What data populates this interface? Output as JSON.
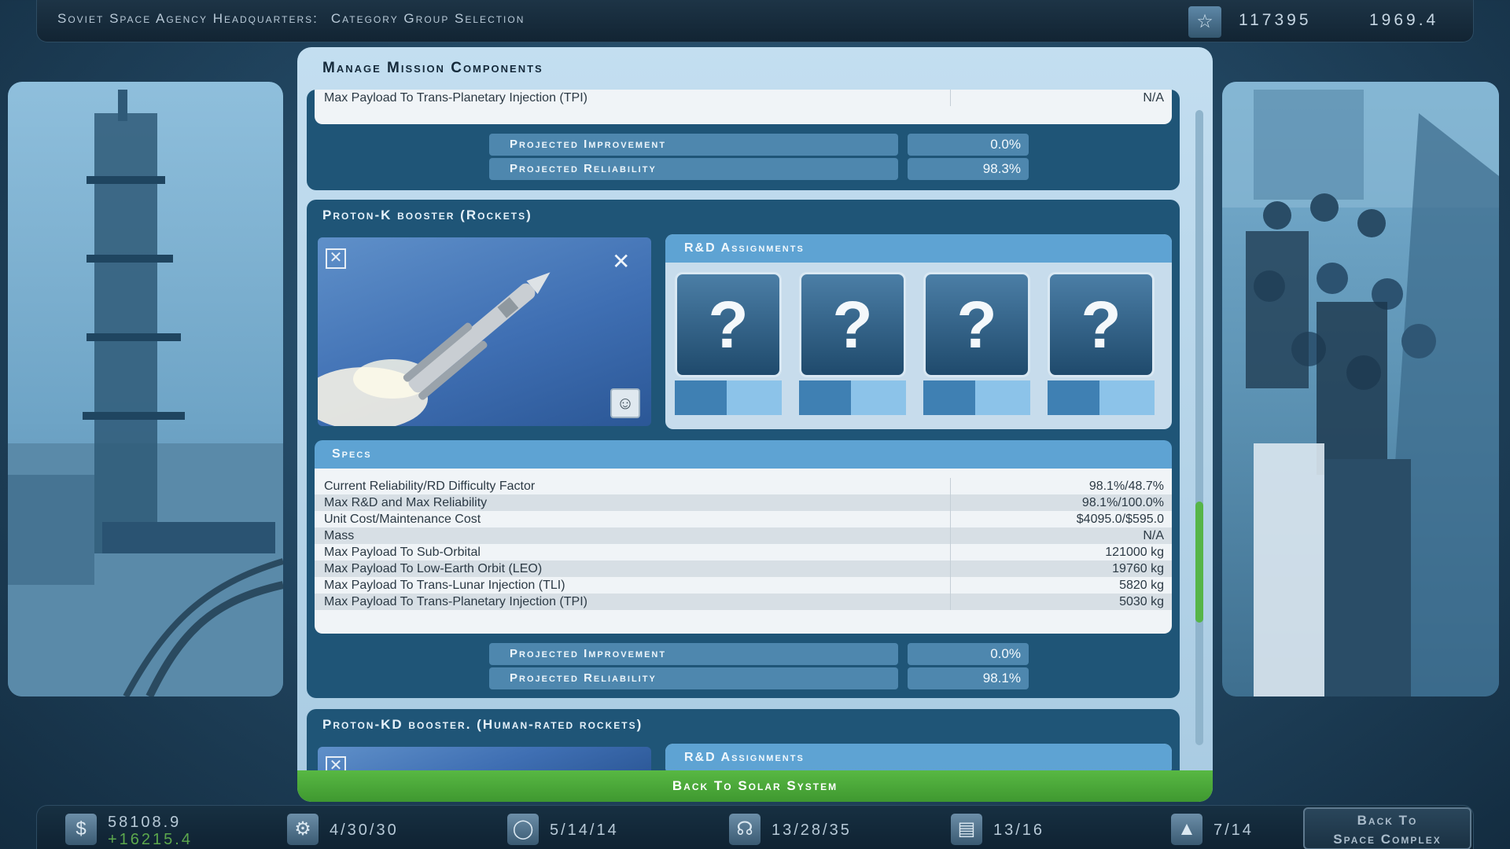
{
  "topbar": {
    "location": "Soviet Space Agency Headquarters:",
    "screen": "Category Group Selection",
    "prestige": "117395",
    "date": "1969.4"
  },
  "panel": {
    "header": "Manage Mission Components",
    "back_button": "Back To Solar System"
  },
  "card0": {
    "row_label": "Max Payload To Trans-Planetary Injection (TPI)",
    "row_value": "N/A",
    "improvement_label": "Projected Improvement",
    "improvement_value": "0.0%",
    "reliability_label": "Projected Reliability",
    "reliability_value": "98.3%"
  },
  "card1": {
    "title": "Proton-K booster (Rockets)",
    "rd_header": "R&D Assignments",
    "slots": [
      "?",
      "?",
      "?",
      "?"
    ],
    "specs_header": "Specs",
    "specs": [
      {
        "label": "Current Reliability/RD Difficulty Factor",
        "value": "98.1%/48.7%"
      },
      {
        "label": "Max R&D and Max Reliability",
        "value": "98.1%/100.0%"
      },
      {
        "label": "Unit Cost/Maintenance Cost",
        "value": "$4095.0/$595.0"
      },
      {
        "label": "Mass",
        "value": "N/A"
      },
      {
        "label": "Max Payload To Sub-Orbital",
        "value": "121000 kg"
      },
      {
        "label": "Max Payload To Low-Earth Orbit (LEO)",
        "value": "19760 kg"
      },
      {
        "label": "Max Payload To Trans-Lunar Injection (TLI)",
        "value": "5820 kg"
      },
      {
        "label": "Max Payload To Trans-Planetary Injection (TPI)",
        "value": "5030 kg"
      }
    ],
    "improvement_label": "Projected Improvement",
    "improvement_value": "0.0%",
    "reliability_label": "Projected Reliability",
    "reliability_value": "98.1%"
  },
  "card2": {
    "title": "Proton-KD booster. (Human-rated rockets)",
    "rd_header": "R&D Assignments"
  },
  "bottombar": {
    "money": "58108.9",
    "income": "+16215.4",
    "stat1": "4/30/30",
    "stat2": "5/14/14",
    "stat3": "13/28/35",
    "stat4": "13/16",
    "stat5": "7/14",
    "back_line1": "Back To",
    "back_line2": "Space Complex"
  },
  "icons": {
    "star": "star-icon",
    "money": "dollar-icon",
    "gear": "gear-icon",
    "capsule": "capsule-icon",
    "headset": "headset-icon",
    "folder": "folder-icon",
    "city": "city-icon"
  },
  "colors": {
    "accent_green": "#56b548",
    "panel_blue": "#1f5577",
    "header_blue": "#5ea3d3"
  }
}
